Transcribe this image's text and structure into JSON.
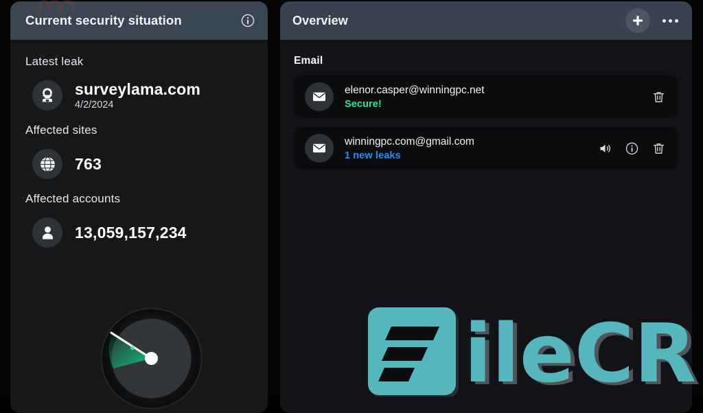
{
  "left_panel": {
    "title": "Current security situation",
    "info_icon": "info-circle-icon",
    "stats": [
      {
        "label": "Latest leak",
        "icon": "hacker-hood-icon",
        "value": "surveylama.com",
        "sub": "4/2/2024"
      },
      {
        "label": "Affected sites",
        "icon": "globe-icon",
        "value": "763",
        "sub": ""
      },
      {
        "label": "Affected accounts",
        "icon": "person-icon",
        "value": "13,059,157,234",
        "sub": ""
      }
    ],
    "gauge": {
      "name": "radar-sweep-gauge",
      "sweep_color": "#13b877",
      "needle_angle_deg": -153
    }
  },
  "right_panel": {
    "title": "Overview",
    "add_icon": "plus-icon",
    "more_icon": "ellipsis-icon",
    "section_label": "Email",
    "items": [
      {
        "avatar_icon": "envelope-icon",
        "address": "elenor.casper@winningpc.net",
        "status": "Secure!",
        "status_color": "#25e6a0",
        "actions": [
          "trash-icon"
        ]
      },
      {
        "avatar_icon": "envelope-icon",
        "address": "winningpc.com@gmail.com",
        "status": "1 new leaks",
        "status_color": "#1f8ff5",
        "actions": [
          "speaker-icon",
          "info-circle-icon",
          "trash-icon"
        ]
      }
    ]
  },
  "watermark": {
    "text": "ileCR",
    "logo_letter": "F",
    "color": "#56b6bd"
  },
  "theme": {
    "page_background": "#050505",
    "panel_background": "#151719",
    "header_background": "#3b4653",
    "accent_green": "#25e6a0",
    "accent_blue": "#1f8ff5"
  }
}
